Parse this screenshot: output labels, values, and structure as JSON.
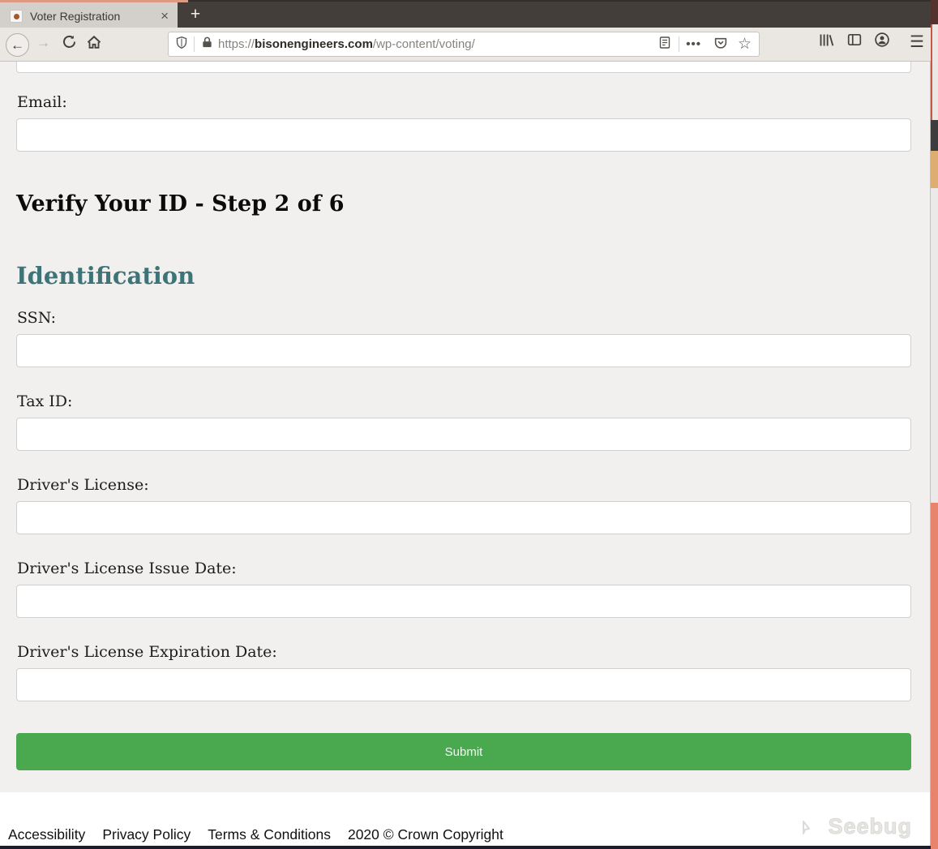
{
  "browser": {
    "tab": {
      "title": "Voter Registration",
      "close_label": "×",
      "new_tab_label": "+"
    },
    "url": {
      "scheme": "https://",
      "domain": "bisonengineers.com",
      "path": "/wp-content/voting/"
    },
    "dots_label": "•••",
    "star_label": "☆",
    "hamburger_label": "☰",
    "back_label": "←",
    "forward_label": "→"
  },
  "page": {
    "email_label": "Email:",
    "email_value": "",
    "step_heading": "Verify Your ID - Step 2 of 6",
    "section_heading": "Identification",
    "fields": [
      {
        "label": "SSN:",
        "value": ""
      },
      {
        "label": "Tax ID:",
        "value": ""
      },
      {
        "label": "Driver's License:",
        "value": ""
      },
      {
        "label": "Driver's License Issue Date:",
        "value": ""
      },
      {
        "label": "Driver's License Expiration Date:",
        "value": ""
      }
    ],
    "submit_label": "Submit",
    "colors": {
      "section_heading": "#3e7378",
      "submit_green": "#4aa84f",
      "page_bg": "#f1f0ee"
    }
  },
  "footer": {
    "links": [
      "Accessibility",
      "Privacy Policy",
      "Terms & Conditions"
    ],
    "copyright": "2020 © Crown Copyright",
    "watermark": "Seebug"
  }
}
